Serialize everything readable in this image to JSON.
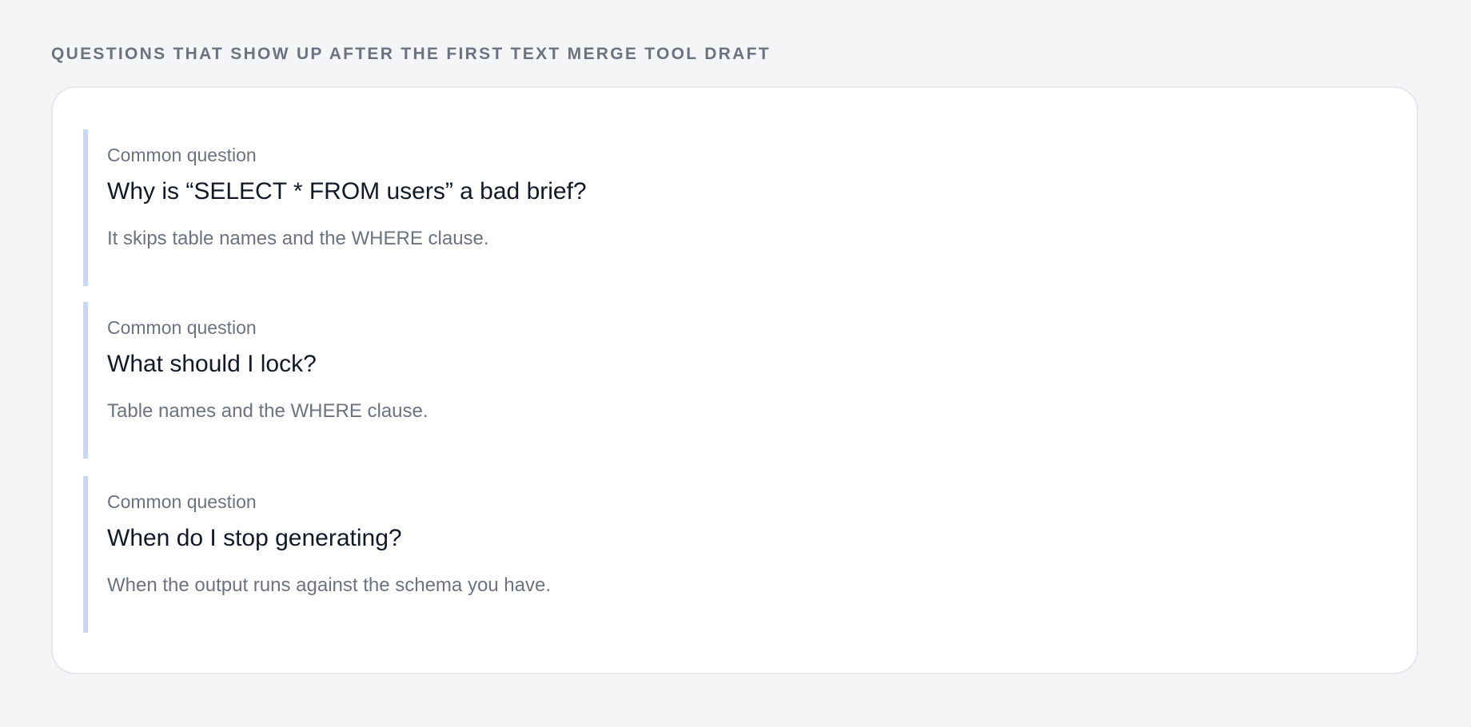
{
  "section": {
    "heading": "QUESTIONS THAT SHOW UP AFTER THE FIRST TEXT MERGE TOOL DRAFT"
  },
  "faq": [
    {
      "label": "Common question",
      "question": "Why is “SELECT * FROM users” a bad brief?",
      "answer": "It skips table names and the WHERE clause."
    },
    {
      "label": "Common question",
      "question": "What should I lock?",
      "answer": "Table names and the WHERE clause."
    },
    {
      "label": "Common question",
      "question": "When do I stop generating?",
      "answer": "When the output runs against the schema you have."
    }
  ],
  "colors": {
    "background": "#f4f5f7",
    "card": "#ffffff",
    "accent_bar": "#c7d6f5",
    "heading_text": "#6b7280",
    "question_text": "#111827",
    "muted_text": "#6b7280"
  }
}
